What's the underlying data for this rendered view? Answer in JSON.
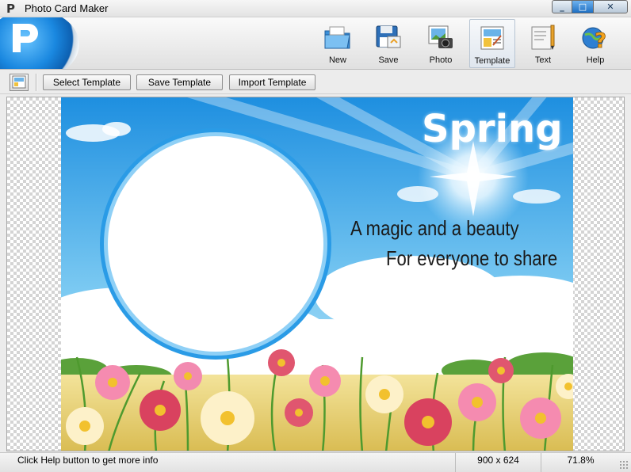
{
  "window": {
    "title": "Photo Card Maker",
    "controls": {
      "minimize": "_",
      "maximize": "□",
      "close": "✕"
    }
  },
  "toolbar": {
    "buttons": [
      {
        "label": "New",
        "icon": "folder-icon"
      },
      {
        "label": "Save",
        "icon": "save-icon"
      },
      {
        "label": "Photo",
        "icon": "photo-camera-icon"
      },
      {
        "label": "Template",
        "icon": "template-icon",
        "active": true
      },
      {
        "label": "Text",
        "icon": "text-pencil-icon"
      },
      {
        "label": "Help",
        "icon": "help-globe-icon"
      }
    ]
  },
  "subtoolbar": {
    "icon": "template-small-icon",
    "buttons": [
      {
        "label": "Select Template"
      },
      {
        "label": "Save Template"
      },
      {
        "label": "Import Template"
      }
    ]
  },
  "card": {
    "title": "Spring",
    "line1": "A magic and a beauty",
    "line2": "For everyone to share",
    "colors": {
      "sky_top": "#1e8fe0",
      "sky_bottom": "#bfe4f6",
      "frame": "#2a9be6",
      "grass": "#e8d57a"
    }
  },
  "statusbar": {
    "message": "Click Help button to get more info",
    "size": "900 x 624",
    "zoom": "71.8%"
  }
}
